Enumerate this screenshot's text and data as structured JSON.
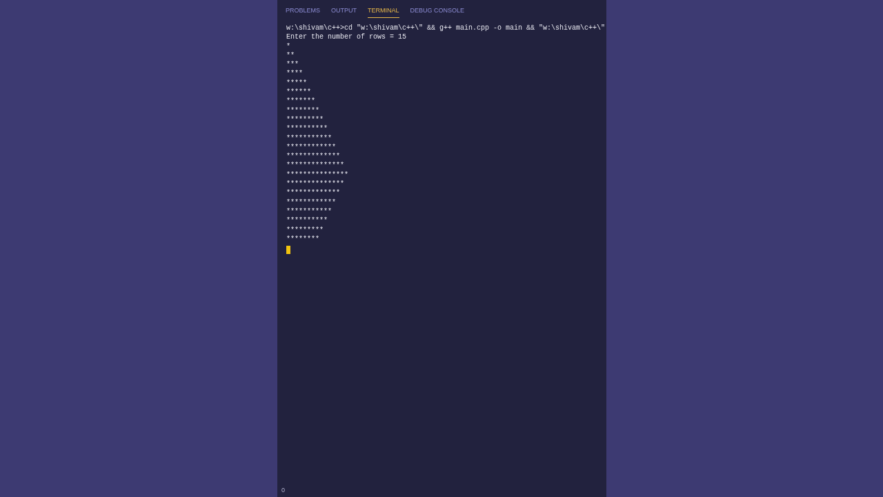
{
  "tabs": [
    {
      "label": "PROBLEMS",
      "selected": false
    },
    {
      "label": "OUTPUT",
      "selected": false
    },
    {
      "label": "TERMINAL",
      "selected": true
    },
    {
      "label": "DEBUG CONSOLE",
      "selected": false
    }
  ],
  "terminal": {
    "command": "w:\\shivam\\c++>cd \"w:\\shivam\\c++\\\" && g++ main.cpp -o main && \"w:\\shivam\\c++\\\"",
    "prompt": "Enter the number of rows = 15",
    "output": "*\n**\n***\n****\n*****\n******\n*******\n********\n*********\n**********\n***********\n************\n*************\n**************\n***************\n**************\n*************\n************\n***********\n**********\n*********\n********",
    "cursor": true
  },
  "status_bar": {
    "count": "0"
  }
}
